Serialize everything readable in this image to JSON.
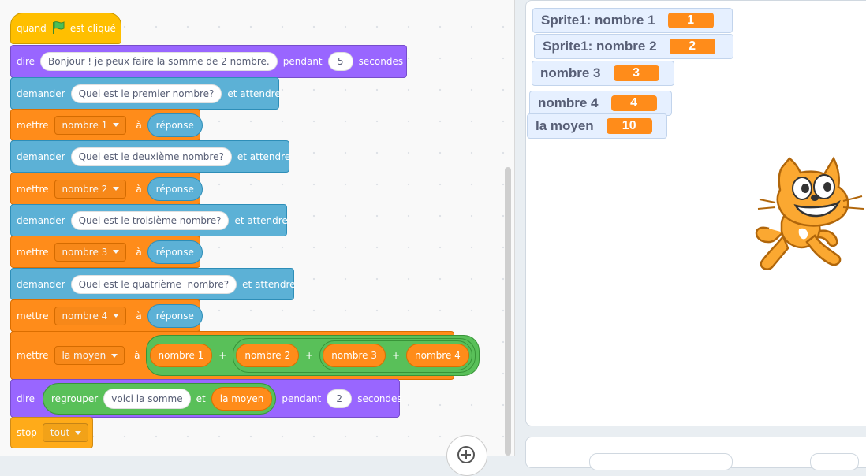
{
  "code": {
    "when_flag": {
      "label_before": "quand",
      "label_after": "est cliqué"
    },
    "say1": {
      "verb": "dire",
      "message": "Bonjour ! je peux faire la somme de 2 nombre.",
      "pendant": "pendant",
      "secs": "5",
      "unit": "secondes"
    },
    "asks": [
      {
        "verb": "demander",
        "question": "Quel est le premier nombre?",
        "suffix": "et attendre"
      },
      {
        "verb": "demander",
        "question": "Quel est le deuxième nombre?",
        "suffix": "et attendre"
      },
      {
        "verb": "demander",
        "question": "Quel est le troisième nombre?",
        "suffix": "et attendre"
      },
      {
        "verb": "demander",
        "question": "Quel est le quatrième  nombre?",
        "suffix": "et attendre"
      }
    ],
    "sets": [
      {
        "verb": "mettre",
        "var": "nombre 1",
        "a": "à",
        "value": "réponse"
      },
      {
        "verb": "mettre",
        "var": "nombre 2",
        "a": "à",
        "value": "réponse"
      },
      {
        "verb": "mettre",
        "var": "nombre 3",
        "a": "à",
        "value": "réponse"
      },
      {
        "verb": "mettre",
        "var": "nombre 4",
        "a": "à",
        "value": "réponse"
      }
    ],
    "set_sum": {
      "verb": "mettre",
      "var": "la moyen",
      "a": "à",
      "terms": [
        "nombre 1",
        "nombre 2",
        "nombre 3",
        "nombre 4"
      ],
      "plus": "+"
    },
    "say2": {
      "verb": "dire",
      "join": "regrouper",
      "text": "voici la somme",
      "and": "et",
      "var": "la moyen",
      "pendant": "pendant",
      "secs": "2",
      "unit": "secondes"
    },
    "stop": {
      "verb": "stop",
      "option": "tout"
    }
  },
  "monitors": [
    {
      "label": "Sprite1: nombre 1",
      "value": "1"
    },
    {
      "label": "Sprite1: nombre 2",
      "value": "2"
    },
    {
      "label": "nombre 3",
      "value": "3"
    },
    {
      "label": "nombre 4",
      "value": "4"
    },
    {
      "label": "la moyen",
      "value": "10"
    }
  ],
  "colors": {
    "events": "#ffbf00",
    "looks": "#9966ff",
    "sensing": "#5cb1d6",
    "variables": "#ff8c1a",
    "operators": "#59c059",
    "control": "#ffab19"
  },
  "icons": {
    "flag": "green-flag-icon",
    "dropdown": "caret-down-icon",
    "zoom": "zoom-in-icon",
    "sprite": "scratch-cat-sprite"
  }
}
